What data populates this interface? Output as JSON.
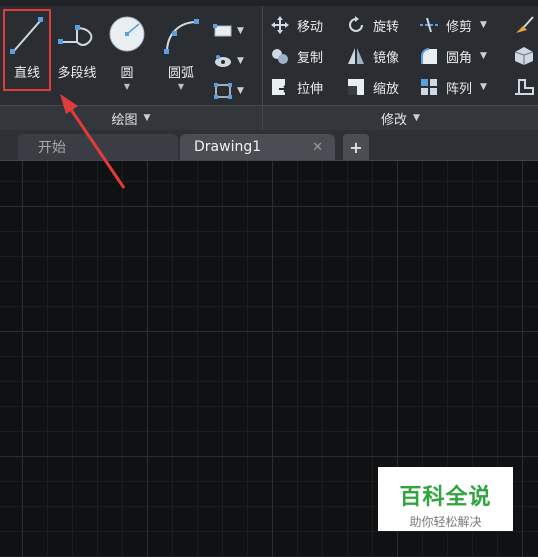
{
  "ribbon": {
    "draw_panel": {
      "title": "绘图",
      "tools": [
        {
          "label": "直线",
          "icon": "line-icon"
        },
        {
          "label": "多段线",
          "icon": "polyline-icon"
        },
        {
          "label": "圆",
          "icon": "circle-icon"
        },
        {
          "label": "圆弧",
          "icon": "arc-icon"
        }
      ],
      "small_icons": [
        "rectangle-icon",
        "hatch-icon",
        "array-box-icon"
      ]
    },
    "modify_panel": {
      "title": "修改",
      "items": [
        {
          "label": "移动",
          "icon": "move-icon"
        },
        {
          "label": "旋转",
          "icon": "rotate-icon"
        },
        {
          "label": "修剪",
          "icon": "trim-icon"
        },
        {
          "label": "复制",
          "icon": "copy-icon"
        },
        {
          "label": "镜像",
          "icon": "mirror-icon"
        },
        {
          "label": "圆角",
          "icon": "fillet-icon"
        },
        {
          "label": "拉伸",
          "icon": "stretch-icon"
        },
        {
          "label": "缩放",
          "icon": "scale-icon"
        },
        {
          "label": "阵列",
          "icon": "array-icon"
        }
      ]
    }
  },
  "tabs": {
    "start": "开始",
    "drawing": "Drawing1",
    "close_glyph": "✕",
    "add_glyph": "+"
  },
  "watermark": {
    "title": "百科全说",
    "subtitle": "助你轻松解决"
  },
  "colors": {
    "highlight": "#e23b3b",
    "watermark_green": "#2fa53d"
  }
}
